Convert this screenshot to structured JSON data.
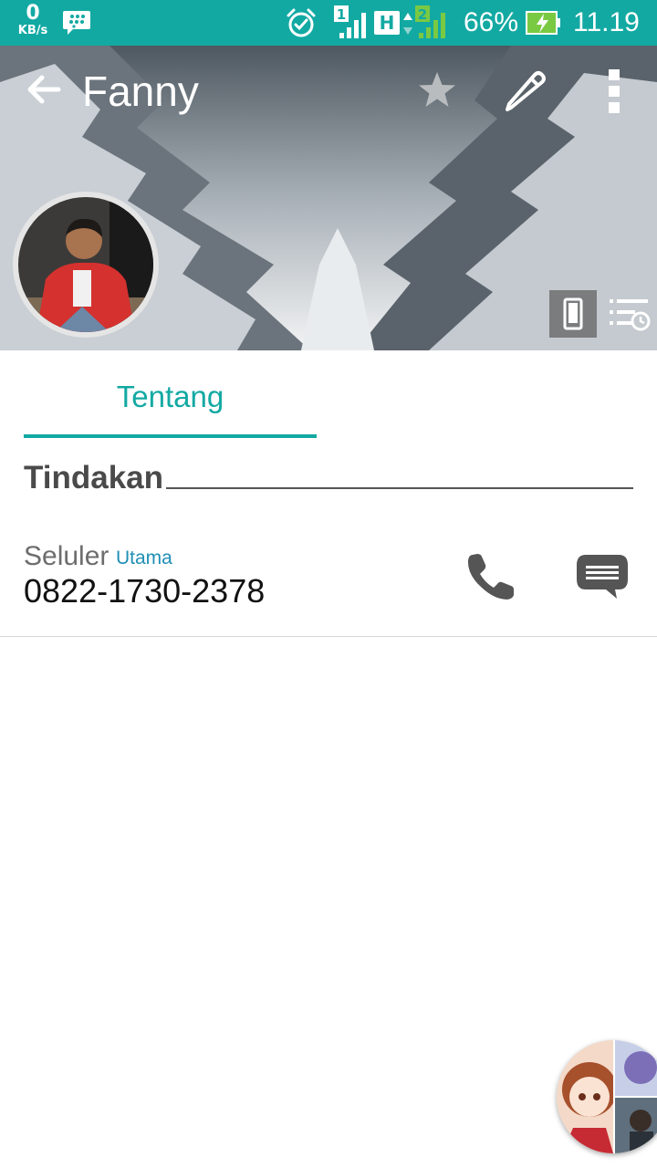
{
  "status_bar": {
    "speed_value": "0",
    "speed_unit": "KB/s",
    "sim1_label": "1",
    "network_type": "H",
    "sim2_label": "2",
    "battery_percent": "66%",
    "time": "11.19",
    "icons": [
      "bbm-icon",
      "alarm-icon",
      "signal-icon",
      "battery-charging-icon"
    ],
    "accent_color": "#13a9a3"
  },
  "header": {
    "contact_name": "Fanny",
    "icons": [
      "back-arrow-icon",
      "star-icon",
      "edit-pencil-icon",
      "more-vert-icon",
      "phone-device-icon",
      "call-history-icon"
    ]
  },
  "tabs": [
    {
      "label": "Tentang",
      "active": true
    }
  ],
  "section": {
    "title": "Tindakan"
  },
  "phone_entry": {
    "type": "Seluler",
    "tag": "Utama",
    "number": "0822-1730-2378",
    "icons": [
      "phone-call-icon",
      "message-icon"
    ]
  }
}
